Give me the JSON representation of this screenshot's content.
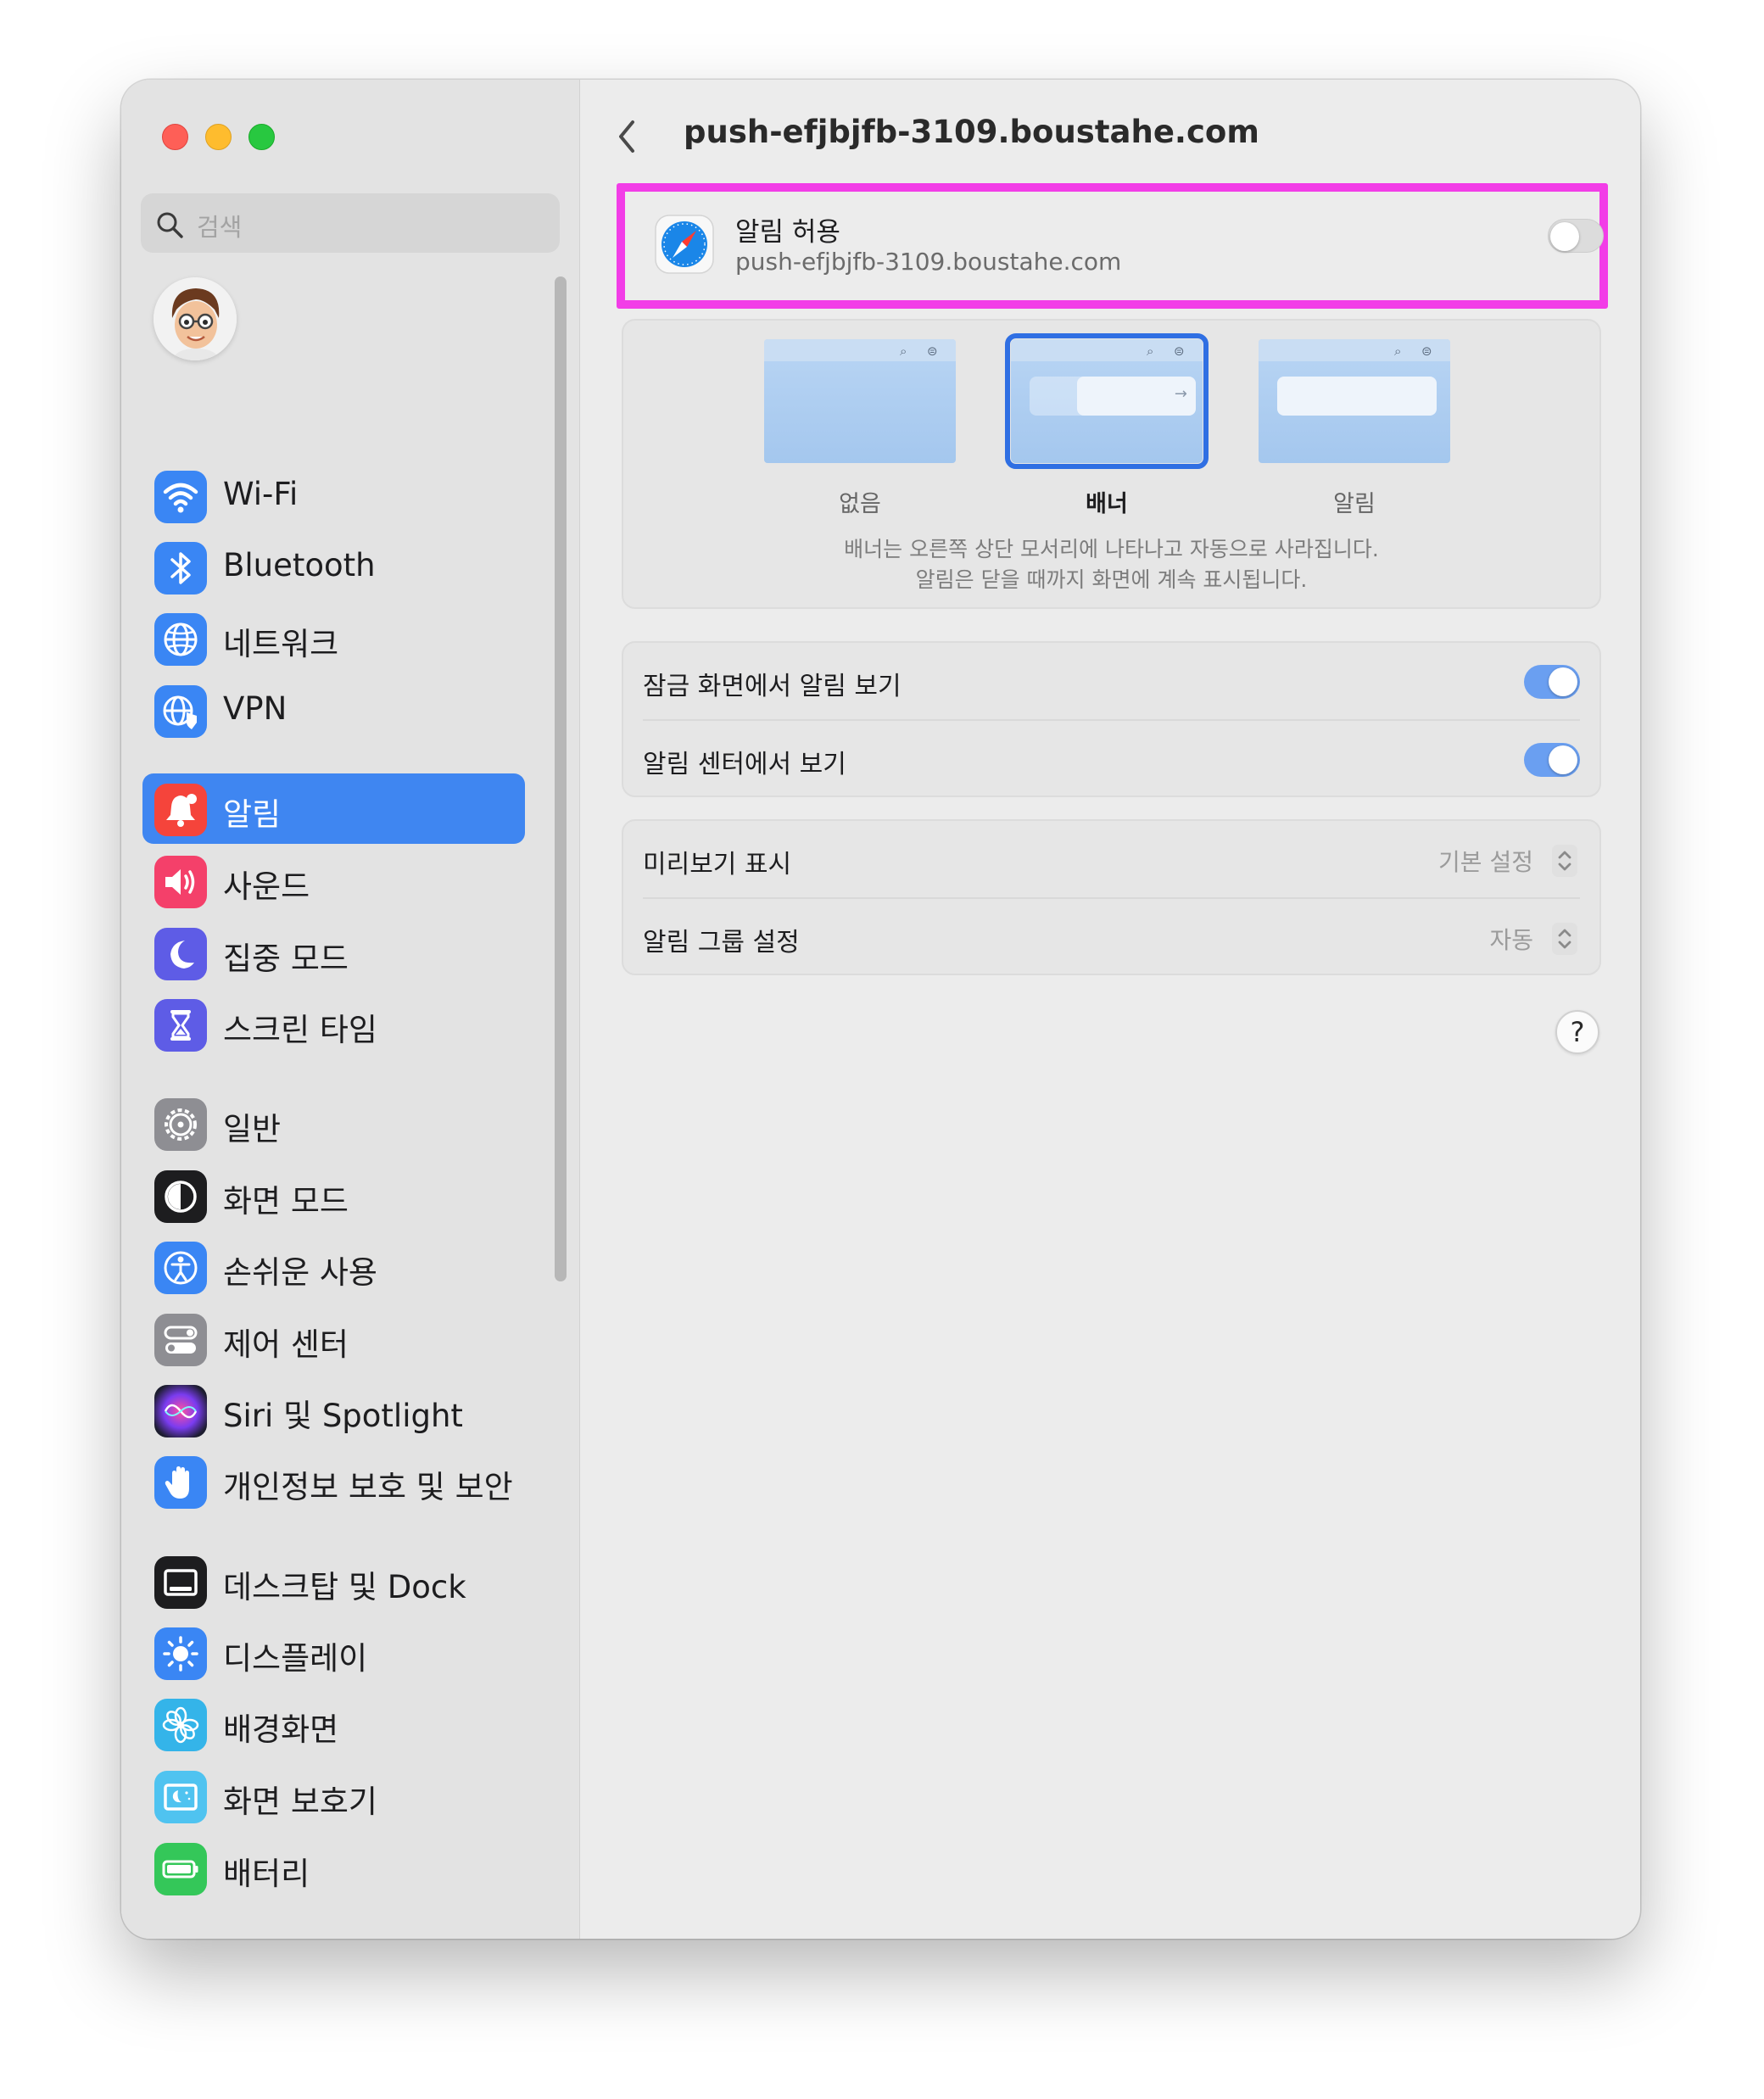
{
  "search": {
    "placeholder": "검색"
  },
  "sidebar": {
    "items": [
      {
        "label": "Wi-Fi",
        "icon": "wifi-icon",
        "color": "#3a86f4"
      },
      {
        "label": "Bluetooth",
        "icon": "bluetooth-icon",
        "color": "#3a86f4"
      },
      {
        "label": "네트워크",
        "icon": "globe-icon",
        "color": "#3a86f4"
      },
      {
        "label": "VPN",
        "icon": "vpn-icon",
        "color": "#3a86f4"
      },
      {
        "label": "알림",
        "icon": "bell-icon",
        "color": "#f5443b",
        "selected": true
      },
      {
        "label": "사운드",
        "icon": "speaker-icon",
        "color": "#f4406a"
      },
      {
        "label": "집중 모드",
        "icon": "moon-icon",
        "color": "#5e5ce6"
      },
      {
        "label": "스크린 타임",
        "icon": "hourglass-icon",
        "color": "#5e5ce6"
      },
      {
        "label": "일반",
        "icon": "gear-icon",
        "color": "#8e8e93"
      },
      {
        "label": "화면 모드",
        "icon": "appearance-icon",
        "color": "#1d1d1f"
      },
      {
        "label": "손쉬운 사용",
        "icon": "accessibility-icon",
        "color": "#3a86f4"
      },
      {
        "label": "제어 센터",
        "icon": "control-center-icon",
        "color": "#8e8e93"
      },
      {
        "label": "Siri 및 Spotlight",
        "icon": "siri-icon",
        "color": "#b04ad2"
      },
      {
        "label": "개인정보 보호 및 보안",
        "icon": "hand-icon",
        "color": "#3a86f4"
      },
      {
        "label": "데스크탑 및 Dock",
        "icon": "dock-icon",
        "color": "#1d1d1f"
      },
      {
        "label": "디스플레이",
        "icon": "sun-icon",
        "color": "#3a86f4"
      },
      {
        "label": "배경화면",
        "icon": "flower-icon",
        "color": "#34b4e9"
      },
      {
        "label": "화면 보호기",
        "icon": "screensaver-icon",
        "color": "#4fc3f0"
      },
      {
        "label": "배터리",
        "icon": "battery-icon",
        "color": "#34c759"
      }
    ]
  },
  "header": {
    "title": "push-efjbjfb-3109.boustahe.com"
  },
  "allow": {
    "title": "알림 허용",
    "subtitle": "push-efjbjfb-3109.boustahe.com",
    "enabled": false,
    "highlight_color": "#f23de7"
  },
  "styles": {
    "options": [
      {
        "label": "없음",
        "selected": false
      },
      {
        "label": "배너",
        "selected": true
      },
      {
        "label": "알림",
        "selected": false
      }
    ],
    "description_line1": "배너는 오른쪽 상단 모서리에 나타나고 자동으로 사라집니다.",
    "description_line2": "알림은 닫을 때까지 화면에 계속 표시됩니다."
  },
  "toggles": [
    {
      "label": "잠금 화면에서 알림 보기",
      "enabled": true
    },
    {
      "label": "알림 센터에서 보기",
      "enabled": true
    }
  ],
  "options": [
    {
      "label": "미리보기 표시",
      "value": "기본 설정"
    },
    {
      "label": "알림 그룹 설정",
      "value": "자동"
    }
  ],
  "help": {
    "label": "?"
  }
}
